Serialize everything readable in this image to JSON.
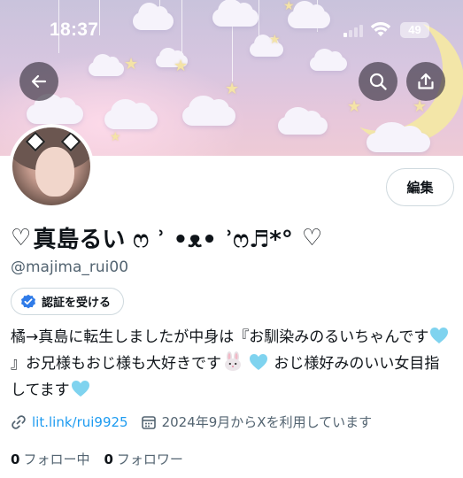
{
  "status_bar": {
    "time": "18:37",
    "battery": "49"
  },
  "header": {
    "back_icon": "arrow-left-icon",
    "search_icon": "search-icon",
    "share_icon": "share-upload-icon"
  },
  "profile": {
    "edit_label": "編集",
    "display_name_prefix": "♡",
    "display_name": "真島るい ෆ ʾ •ᴥ• ʾෆ♬*°",
    "display_name_suffix": "♡",
    "handle": "@majima_rui00",
    "verify_label": "認証を受ける",
    "bio_part1": "橘→真島に転生しましたが中身は『お馴染みのるいちゃんです",
    "bio_part2": "』お兄様もおじ様も大好きです",
    "bio_part3": "おじ様好みのいい女目指してます",
    "bio_emoji_heart": "light-blue-heart",
    "bio_emoji_bunny": "rabbit-face",
    "link": "lit.link/rui9925",
    "joined": "2024年9月からXを利用しています",
    "following_count": "0",
    "following_label": "フォロー中",
    "followers_count": "0",
    "followers_label": "フォロワー"
  },
  "colors": {
    "accent": "#1d9bf0",
    "text": "#0f1419",
    "muted": "#536471",
    "border": "#cfd9de",
    "verify_badge": "#2f7be8",
    "heart_emoji": "#7fd3ef"
  }
}
